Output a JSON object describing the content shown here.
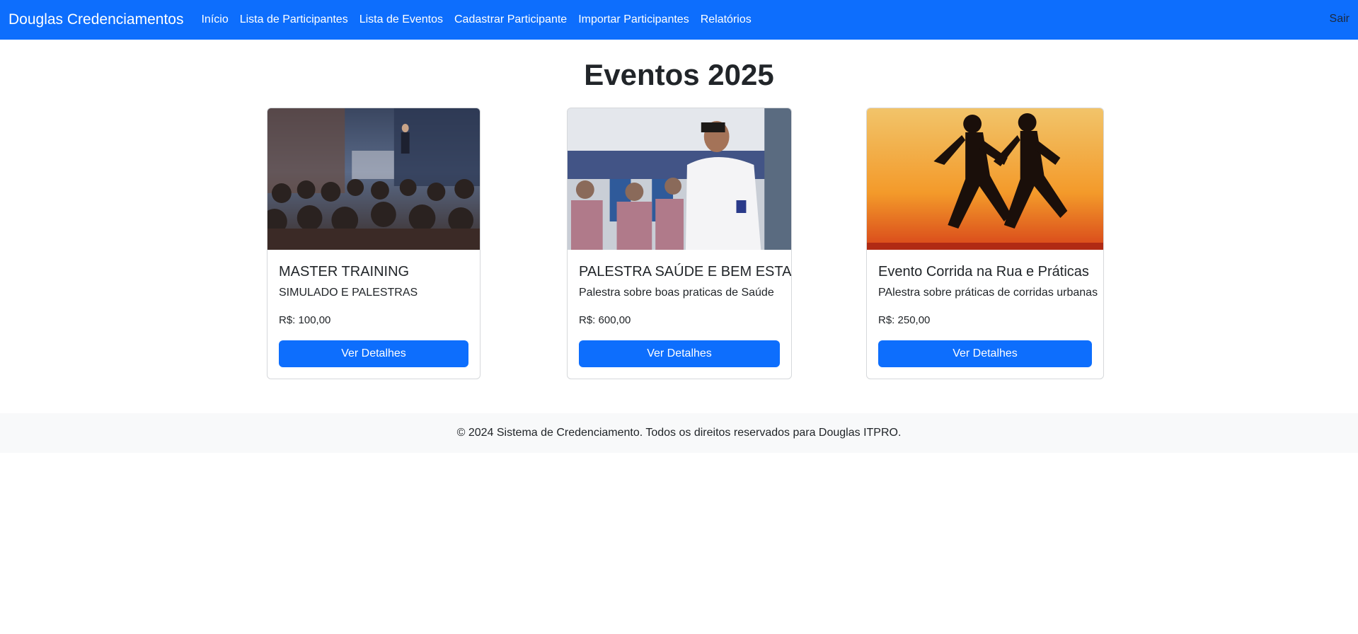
{
  "navbar": {
    "brand": "Douglas Credenciamentos",
    "links": [
      "Início",
      "Lista de Participantes",
      "Lista de Eventos",
      "Cadastrar Participante",
      "Importar Participantes",
      "Relatórios"
    ],
    "logout": "Sair"
  },
  "page": {
    "title": "Eventos 2025"
  },
  "events": [
    {
      "title": "MASTER TRAINING",
      "description": "SIMULADO E PALESTRAS",
      "price": "R$: 100,00",
      "button": "Ver Detalhes",
      "image": "conference-audience-photo"
    },
    {
      "title": "PALESTRA SAÚDE E BEM ESTAR",
      "description": "Palestra sobre boas praticas de Saúde",
      "price": "R$: 600,00",
      "button": "Ver Detalhes",
      "image": "health-talk-photo"
    },
    {
      "title": "Evento Corrida na Rua e Práticas",
      "description": "PAlestra sobre práticas de corridas urbanas",
      "price": "R$: 250,00",
      "button": "Ver Detalhes",
      "image": "runners-sunset-photo"
    }
  ],
  "footer": {
    "text": "© 2024 Sistema de Credenciamento. Todos os direitos reservados para Douglas ITPRO."
  },
  "colors": {
    "primary": "#0d6efd",
    "footer_bg": "#f8f9fa",
    "text": "#212529"
  }
}
